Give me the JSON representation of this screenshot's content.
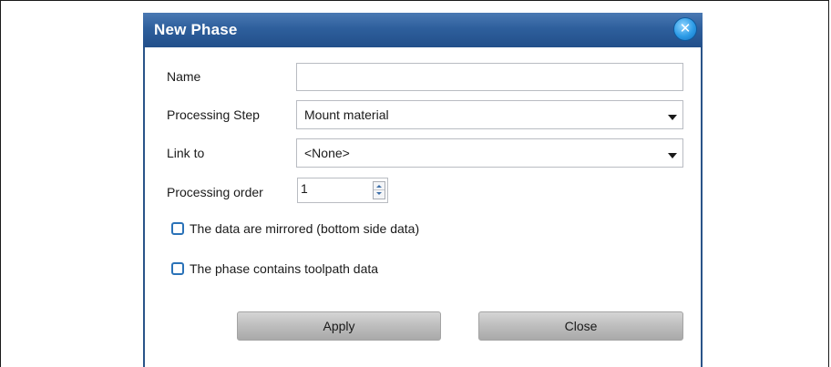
{
  "dialog": {
    "title": "New Phase",
    "close_icon": "close-icon",
    "accent_color": "#2e5f9c"
  },
  "form": {
    "name_label": "Name",
    "name_value": "",
    "processing_step_label": "Processing Step",
    "processing_step_value": "Mount material",
    "link_to_label": "Link to",
    "link_to_value": "<None>",
    "processing_order_label": "Processing order",
    "processing_order_value": "1",
    "mirrored_label": "The data are mirrored (bottom side data)",
    "mirrored_checked": false,
    "toolpath_label": "The phase contains toolpath data",
    "toolpath_checked": false
  },
  "buttons": {
    "apply_label": "Apply",
    "close_label": "Close"
  }
}
